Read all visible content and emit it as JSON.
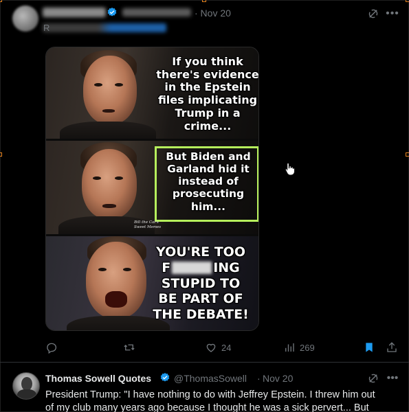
{
  "tweet1": {
    "reply_prefix": "R",
    "date": "· Nov 20",
    "meme": {
      "panel1_text": "If you think there's evidence in the Epstein files implicating Trump in a crime...",
      "panel2_text": "But Biden and Garland hid it instead of prosecuting him...",
      "panel2_watermark_line1": "Bill the Cat's",
      "panel2_watermark_line2": "Sweet Memes",
      "panel3_line1": "YOU'RE TOO",
      "panel3_line2a": "F",
      "panel3_line2b": "ING",
      "panel3_line3": "STUPID TO",
      "panel3_line4": "BE PART OF",
      "panel3_line5": "THE DEBATE!"
    },
    "actions": {
      "likes": "24",
      "views": "269"
    }
  },
  "tweet2": {
    "name": "Thomas Sowell Quotes",
    "handle": "@ThomasSowell",
    "separator": "·",
    "date": "Nov 20",
    "text_line1": "President Trump: \"I have nothing to do with Jeffrey Epstein. I threw him out",
    "text_line2": "of my club many years ago because I thought he was a sick pervert... But"
  },
  "colors": {
    "background": "#000000",
    "muted": "#71767b",
    "text": "#e7e9ea",
    "verified": "#1d9bf0",
    "bookmark": "#1d9bf0",
    "highlight_box": "#b6f05c"
  },
  "icons": {
    "grok": "grok-icon",
    "more": "more-icon",
    "reply": "reply-icon",
    "retweet": "retweet-icon",
    "like": "heart-icon",
    "views": "views-icon",
    "bookmark": "bookmark-icon",
    "share": "share-icon"
  }
}
